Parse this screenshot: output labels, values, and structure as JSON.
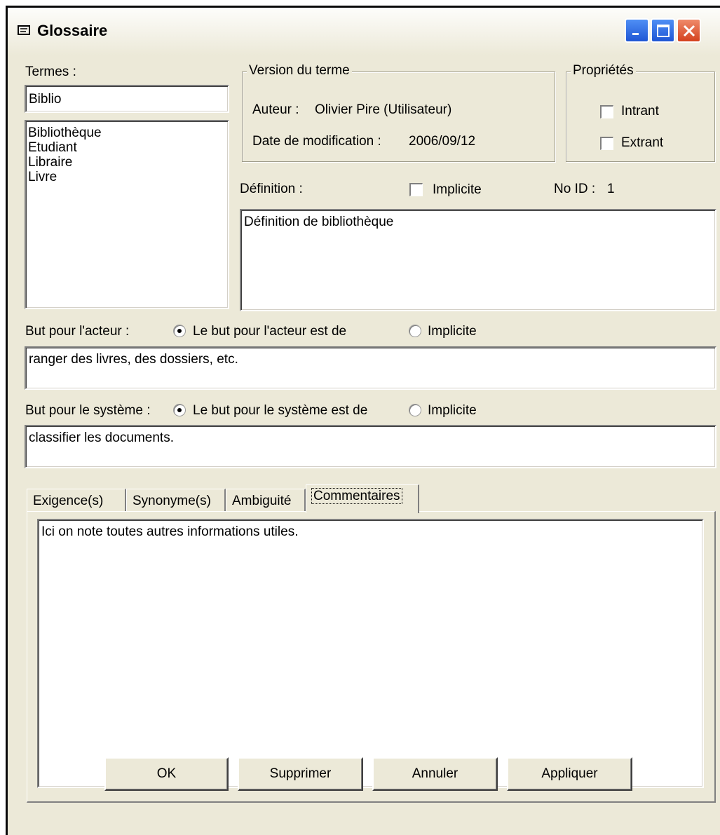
{
  "window": {
    "title": "Glossaire"
  },
  "terms": {
    "label": "Termes :",
    "search_value": "Biblio",
    "items": [
      "Bibliothèque",
      "Etudiant",
      "Libraire",
      "Livre"
    ]
  },
  "version": {
    "legend": "Version du terme",
    "author_label": "Auteur :",
    "author_value": "Olivier Pire (Utilisateur)",
    "date_label": "Date de modification :",
    "date_value": "2006/09/12"
  },
  "properties": {
    "legend": "Propriétés",
    "intrant_label": "Intrant",
    "intrant_checked": false,
    "extrant_label": "Extrant",
    "extrant_checked": false
  },
  "definition": {
    "label": "Définition :",
    "implicit_label": "Implicite",
    "implicit_checked": false,
    "id_label": "No ID :",
    "id_value": "1",
    "text": "Définition de bibliothèque"
  },
  "actor_goal": {
    "label": "But pour l'acteur :",
    "option1": "Le but pour l'acteur est de",
    "option2": "Implicite",
    "selected": "option1",
    "text": "ranger des livres, des dossiers, etc."
  },
  "system_goal": {
    "label": "But pour le système :",
    "option1": "Le but pour le système est de",
    "option2": "Implicite",
    "selected": "option1",
    "text": "classifier les documents."
  },
  "tabs": [
    {
      "label": "Exigence(s)",
      "active": false
    },
    {
      "label": "Synonyme(s)",
      "active": false
    },
    {
      "label": "Ambiguité",
      "active": false
    },
    {
      "label": "Commentaires",
      "active": true
    }
  ],
  "comments": {
    "text": "Ici on note toutes autres informations utiles."
  },
  "buttons": {
    "ok": "OK",
    "delete": "Supprimer",
    "cancel": "Annuler",
    "apply": "Appliquer"
  }
}
